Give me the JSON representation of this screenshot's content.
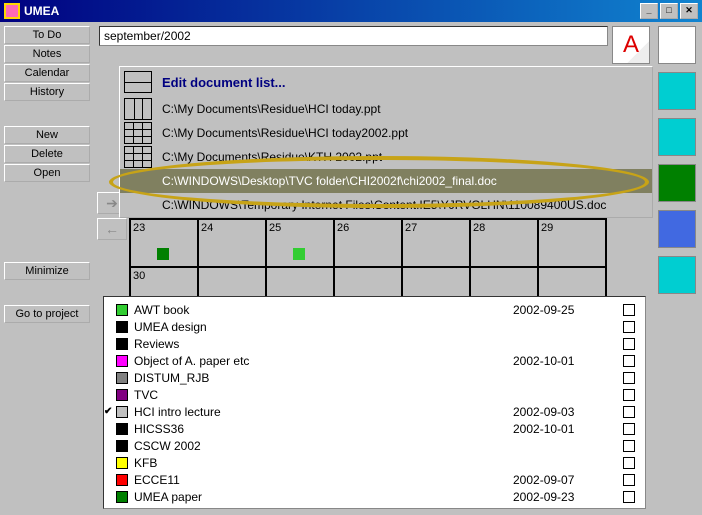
{
  "window": {
    "title": "UMEA"
  },
  "sidebar": {
    "group1": [
      "To Do",
      "Notes",
      "Calendar",
      "History"
    ],
    "group2": [
      "New",
      "Delete",
      "Open"
    ],
    "group3": [
      "Minimize"
    ],
    "group4": [
      "Go to project"
    ]
  },
  "url": {
    "value": "september/2002"
  },
  "doclist": {
    "header": "Edit document list...",
    "items": [
      {
        "path": "C:\\My Documents\\Residue\\HCI today.ppt"
      },
      {
        "path": "C:\\My Documents\\Residue\\HCI today2002.ppt"
      },
      {
        "path": "C:\\My Documents\\Residue\\KTH 2002.ppt"
      },
      {
        "path": "C:\\WINDOWS\\Desktop\\TVC folder\\CHI2002f\\chi2002_final.doc",
        "hl": true
      },
      {
        "path": "C:\\WINDOWS\\Temporary Internet Files\\Content.IE5\\YJRVGLHN\\110089400US.doc"
      }
    ]
  },
  "calendar": {
    "rows": [
      [
        {
          "d": "23",
          "marker": "g1"
        },
        {
          "d": "24"
        },
        {
          "d": "25",
          "marker": "g2"
        },
        {
          "d": "26"
        },
        {
          "d": "27"
        },
        {
          "d": "28"
        },
        {
          "d": "29"
        }
      ],
      [
        {
          "d": "30"
        },
        {
          "d": ""
        },
        {
          "d": ""
        },
        {
          "d": ""
        },
        {
          "d": ""
        },
        {
          "d": ""
        },
        {
          "d": ""
        }
      ]
    ]
  },
  "tasks": [
    {
      "color": "#32cd32",
      "name": "AWT book",
      "date": "2002-09-25"
    },
    {
      "color": "#000000",
      "name": "UMEA  design",
      "date": ""
    },
    {
      "color": "#000000",
      "name": "Reviews",
      "date": ""
    },
    {
      "color": "#ff00ff",
      "name": "Object of A. paper etc",
      "date": "2002-10-01"
    },
    {
      "color": "#808080",
      "name": "DISTUM_RJB",
      "date": ""
    },
    {
      "color": "#800080",
      "name": "TVC",
      "date": ""
    },
    {
      "color": "#c0c0c0",
      "name": "HCI intro lecture",
      "date": "2002-09-03",
      "checked": true
    },
    {
      "color": "#000000",
      "name": "HICSS36",
      "date": "2002-10-01"
    },
    {
      "color": "#000000",
      "name": "CSCW 2002",
      "date": ""
    },
    {
      "color": "#ffff00",
      "name": "KFB",
      "date": ""
    },
    {
      "color": "#ff0000",
      "name": "ECCE11",
      "date": "2002-09-07"
    },
    {
      "color": "#008000",
      "name": "UMEA paper",
      "date": "2002-09-23"
    }
  ],
  "righticons": {
    "colors": [
      "#ffffff",
      "#00ced1",
      "#00ced1",
      "#008000",
      "#4169e1",
      "#00ced1"
    ]
  }
}
